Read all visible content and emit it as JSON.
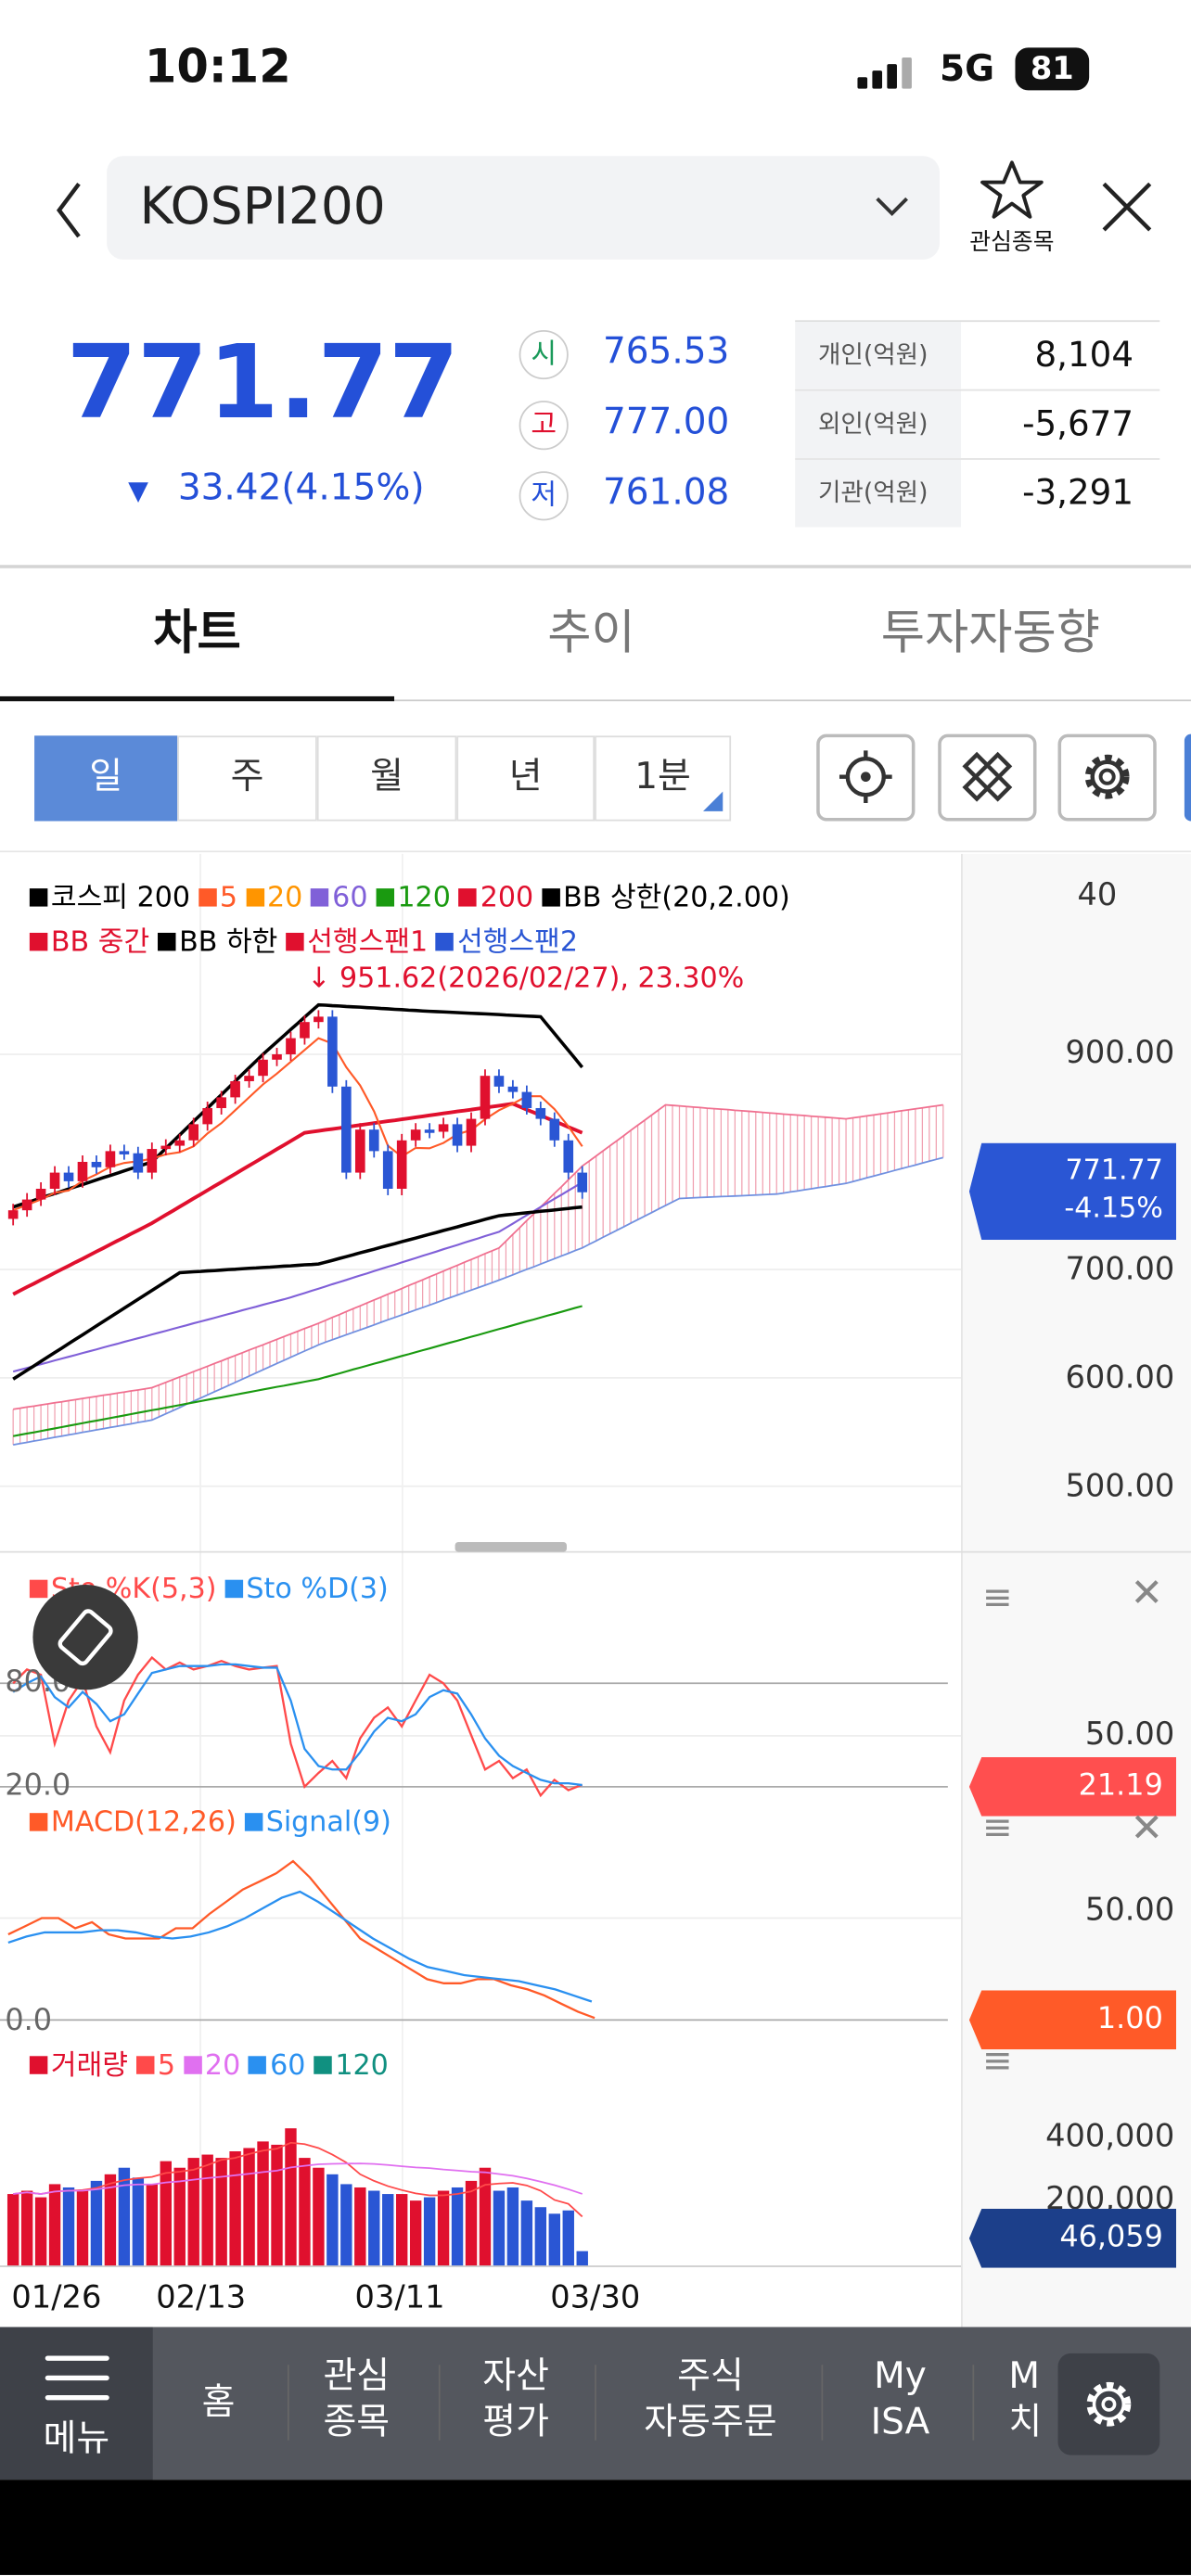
{
  "status": {
    "time": "10:12",
    "network": "5G",
    "battery": "81"
  },
  "header": {
    "symbol": "KOSPI200",
    "favorite_label": "관심종목"
  },
  "quote": {
    "price": "771.77",
    "change": "33.42(4.15%)",
    "open_label": "시",
    "open": "765.53",
    "high_label": "고",
    "high": "777.00",
    "low_label": "저",
    "low": "761.08"
  },
  "investors": [
    {
      "label": "개인(억원)",
      "value": "8,104"
    },
    {
      "label": "외인(억원)",
      "value": "-5,677"
    },
    {
      "label": "기관(억원)",
      "value": "-3,291"
    }
  ],
  "tabs": [
    {
      "label": "차트",
      "active": true
    },
    {
      "label": "추이"
    },
    {
      "label": "투자자동향"
    }
  ],
  "periods": [
    {
      "label": "일",
      "active": true
    },
    {
      "label": "주"
    },
    {
      "label": "월"
    },
    {
      "label": "년"
    },
    {
      "label": "1분"
    }
  ],
  "colors": {
    "up": "#e0102e",
    "down": "#2a56d4",
    "accent": "#2450d8"
  },
  "legend": {
    "row1": [
      {
        "label": "코스피 200",
        "color": "#000000"
      },
      {
        "label": "5",
        "color": "#ff5a28"
      },
      {
        "label": "20",
        "color": "#ff9500"
      },
      {
        "label": "60",
        "color": "#8060d8"
      },
      {
        "label": "120",
        "color": "#1a9a10"
      },
      {
        "label": "200",
        "color": "#e0102e"
      },
      {
        "label": "BB 상한(20,2.00)",
        "color": "#000000"
      }
    ],
    "row2": [
      {
        "label": "BB 중간",
        "color": "#e0102e"
      },
      {
        "label": "BB 하한",
        "color": "#000000"
      },
      {
        "label": "선행스팬1",
        "color": "#e0102e"
      },
      {
        "label": "선행스팬2",
        "color": "#2a56d4"
      }
    ],
    "annotation": "951.62(2026/02/27), 23.30%"
  },
  "price_axis": {
    "top_label": "40",
    "ticks": [
      "900.00",
      "700.00",
      "600.00",
      "500.00"
    ],
    "current": "771.77",
    "current_change": "-4.15%"
  },
  "stoch": {
    "legend": [
      {
        "label": "Sto %K(5,3)",
        "color": "#ff4a4a"
      },
      {
        "label": "Sto %D(3)",
        "color": "#2a90f0"
      }
    ],
    "levels": [
      "80.0",
      "20.0"
    ],
    "axis": "50.00",
    "current": "21.19"
  },
  "macd": {
    "legend": [
      {
        "label": "MACD(12,26)",
        "color": "#ff5a28"
      },
      {
        "label": "Signal(9)",
        "color": "#2a90f0"
      }
    ],
    "level": "0.0",
    "axis": "50.00",
    "current": "1.00"
  },
  "volume": {
    "legend": [
      {
        "label": "거래량",
        "color": "#e0102e"
      },
      {
        "label": "5",
        "color": "#ff4a4a"
      },
      {
        "label": "20",
        "color": "#e070f0"
      },
      {
        "label": "60",
        "color": "#2a90f0"
      },
      {
        "label": "120",
        "color": "#109080"
      }
    ],
    "axis": [
      "400,000",
      "200,000"
    ],
    "current": "46,059"
  },
  "dates": [
    "01/26",
    "02/13",
    "03/11",
    "03/30"
  ],
  "nav": {
    "menu": "메뉴",
    "items": [
      "홈",
      "관심\n종목",
      "자산\n평가",
      "주식\n자동주문",
      "My\nISA",
      "M\n치"
    ]
  },
  "chart_data": {
    "type": "candlestick",
    "closes": [
      755,
      765,
      775,
      790,
      782,
      800,
      795,
      810,
      808,
      790,
      812,
      815,
      820,
      835,
      850,
      860,
      875,
      880,
      895,
      900,
      915,
      930,
      935,
      870,
      790,
      830,
      810,
      775,
      820,
      830,
      828,
      835,
      815,
      840,
      880,
      870,
      865,
      850,
      840,
      820,
      790,
      771.77
    ],
    "bb_upper": [
      [
        0,
        758
      ],
      [
        10,
        800
      ],
      [
        18,
        900
      ],
      [
        22,
        946
      ],
      [
        30,
        940
      ],
      [
        38,
        935
      ],
      [
        41,
        888
      ]
    ],
    "bb_mid": [
      [
        0,
        677
      ],
      [
        10,
        743
      ],
      [
        21,
        827
      ],
      [
        36,
        854
      ],
      [
        41,
        827
      ]
    ],
    "bb_lower": [
      [
        0,
        598
      ],
      [
        12,
        697
      ],
      [
        22,
        705
      ],
      [
        35,
        750
      ],
      [
        41,
        758
      ]
    ],
    "ma60": [
      [
        0,
        605
      ],
      [
        20,
        674
      ],
      [
        35,
        735
      ],
      [
        41,
        781
      ]
    ],
    "ma120": [
      [
        0,
        545
      ],
      [
        22,
        598
      ],
      [
        41,
        666
      ]
    ],
    "span1": [
      [
        0,
        570
      ],
      [
        10,
        590
      ],
      [
        22,
        650
      ],
      [
        35,
        720
      ],
      [
        41,
        796
      ],
      [
        47,
        853
      ],
      [
        55,
        845
      ],
      [
        60,
        840
      ],
      [
        67,
        853
      ]
    ],
    "span2": [
      [
        0,
        537
      ],
      [
        10,
        560
      ],
      [
        22,
        630
      ],
      [
        35,
        690
      ],
      [
        41,
        720
      ],
      [
        48,
        766
      ],
      [
        55,
        770
      ],
      [
        60,
        780
      ],
      [
        67,
        804
      ]
    ],
    "stoch_k": [
      80,
      88,
      85,
      45,
      70,
      82,
      55,
      40,
      70,
      85,
      95,
      88,
      92,
      88,
      90,
      93,
      90,
      88,
      89,
      90,
      45,
      20,
      28,
      35,
      25,
      48,
      60,
      66,
      55,
      70,
      85,
      80,
      70,
      50,
      30,
      35,
      25,
      30,
      15,
      24,
      18,
      21.19
    ],
    "stoch_d": [
      75,
      80,
      84,
      72,
      66,
      75,
      68,
      58,
      62,
      74,
      86,
      88,
      90,
      90,
      90,
      91,
      91,
      90,
      89,
      89,
      70,
      42,
      32,
      30,
      30,
      40,
      52,
      60,
      58,
      62,
      72,
      76,
      74,
      62,
      48,
      38,
      32,
      28,
      24,
      22,
      22,
      21
    ],
    "macd": [
      42,
      46,
      50,
      50,
      45,
      48,
      42,
      40,
      40,
      40,
      45,
      45,
      52,
      58,
      64,
      68,
      72,
      78,
      70,
      60,
      50,
      40,
      35,
      30,
      25,
      20,
      18,
      18,
      20,
      20,
      17,
      15,
      12,
      8,
      4,
      1
    ],
    "signal": [
      38,
      41,
      43,
      43,
      43,
      44,
      44,
      43,
      41,
      40,
      41,
      43,
      46,
      50,
      55,
      60,
      63,
      58,
      52,
      46,
      40,
      35,
      30,
      26,
      24,
      22,
      21,
      20,
      19,
      17,
      15,
      12,
      9
    ],
    "volume": [
      220000,
      230000,
      210000,
      250000,
      240000,
      230000,
      260000,
      280000,
      300000,
      270000,
      250000,
      320000,
      300000,
      330000,
      340000,
      330000,
      350000,
      360000,
      380000,
      370000,
      420000,
      330000,
      300000,
      280000,
      250000,
      240000,
      230000,
      220000,
      220000,
      200000,
      210000,
      230000,
      240000,
      260000,
      300000,
      230000,
      240000,
      200000,
      180000,
      160000,
      170000,
      46059
    ],
    "price_range": [
      400,
      1040
    ]
  }
}
